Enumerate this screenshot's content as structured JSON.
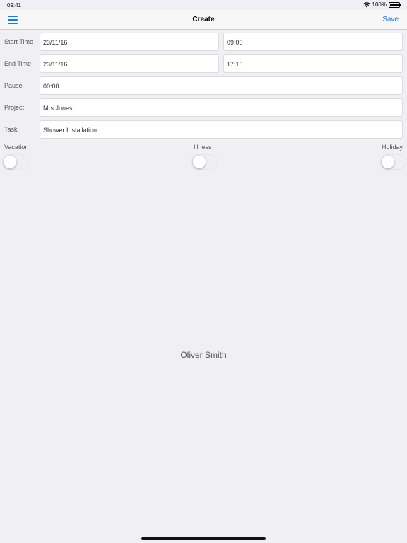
{
  "status": {
    "time": "09:41",
    "battery": "100%"
  },
  "nav": {
    "title": "Create",
    "save_label": "Save"
  },
  "form": {
    "start_time": {
      "label": "Start Time",
      "date": "23/11/16",
      "time": "09:00"
    },
    "end_time": {
      "label": "End Time",
      "date": "23/11/16",
      "time": "17:15"
    },
    "pause": {
      "label": "Pause",
      "value": "00:00"
    },
    "project": {
      "label": "Project",
      "value": "Mrs Jones"
    },
    "task": {
      "label": "Task",
      "value": "Shower Installation"
    }
  },
  "toggles": {
    "vacation": {
      "label": "Vacation",
      "on": false
    },
    "illness": {
      "label": "Illness",
      "on": false
    },
    "holiday": {
      "label": "Holiday",
      "on": false
    }
  },
  "user": {
    "name": "Oliver Smith"
  },
  "colors": {
    "accent": "#1b7cd6",
    "background": "#efeff4"
  },
  "icons": {
    "menu": "hamburger-menu-icon",
    "wifi": "wifi-icon",
    "battery": "battery-icon"
  }
}
